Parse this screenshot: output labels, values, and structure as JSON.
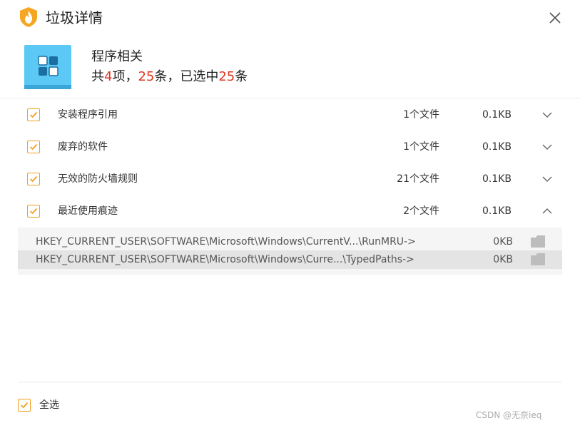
{
  "window": {
    "title": "垃圾详情"
  },
  "category": {
    "name": "程序相关",
    "summary": {
      "p1": "共",
      "items": "4",
      "p2": "项，",
      "entries": "25",
      "p3": "条，已选中",
      "selected": "25",
      "p4": "条"
    }
  },
  "items": [
    {
      "name": "安装程序引用",
      "count": "1个文件",
      "size": "0.1KB",
      "checked": true,
      "expanded": false
    },
    {
      "name": "废弃的软件",
      "count": "1个文件",
      "size": "0.1KB",
      "checked": true,
      "expanded": false
    },
    {
      "name": "无效的防火墙规则",
      "count": "21个文件",
      "size": "0.1KB",
      "checked": true,
      "expanded": false
    },
    {
      "name": "最近使用痕迹",
      "count": "2个文件",
      "size": "0.1KB",
      "checked": true,
      "expanded": true
    }
  ],
  "subitems": [
    {
      "path": "HKEY_CURRENT_USER\\SOFTWARE\\Microsoft\\Windows\\CurrentV...\\RunMRU->",
      "size": "0KB"
    },
    {
      "path": "HKEY_CURRENT_USER\\SOFTWARE\\Microsoft\\Windows\\Curre...\\TypedPaths->",
      "size": "0KB"
    }
  ],
  "footer": {
    "select_all": "全选"
  },
  "watermark": "CSDN @无奈ieq",
  "colors": {
    "accent": "#f0a020",
    "highlight": "#e03420",
    "icon_bg": "#5cc8f5"
  }
}
